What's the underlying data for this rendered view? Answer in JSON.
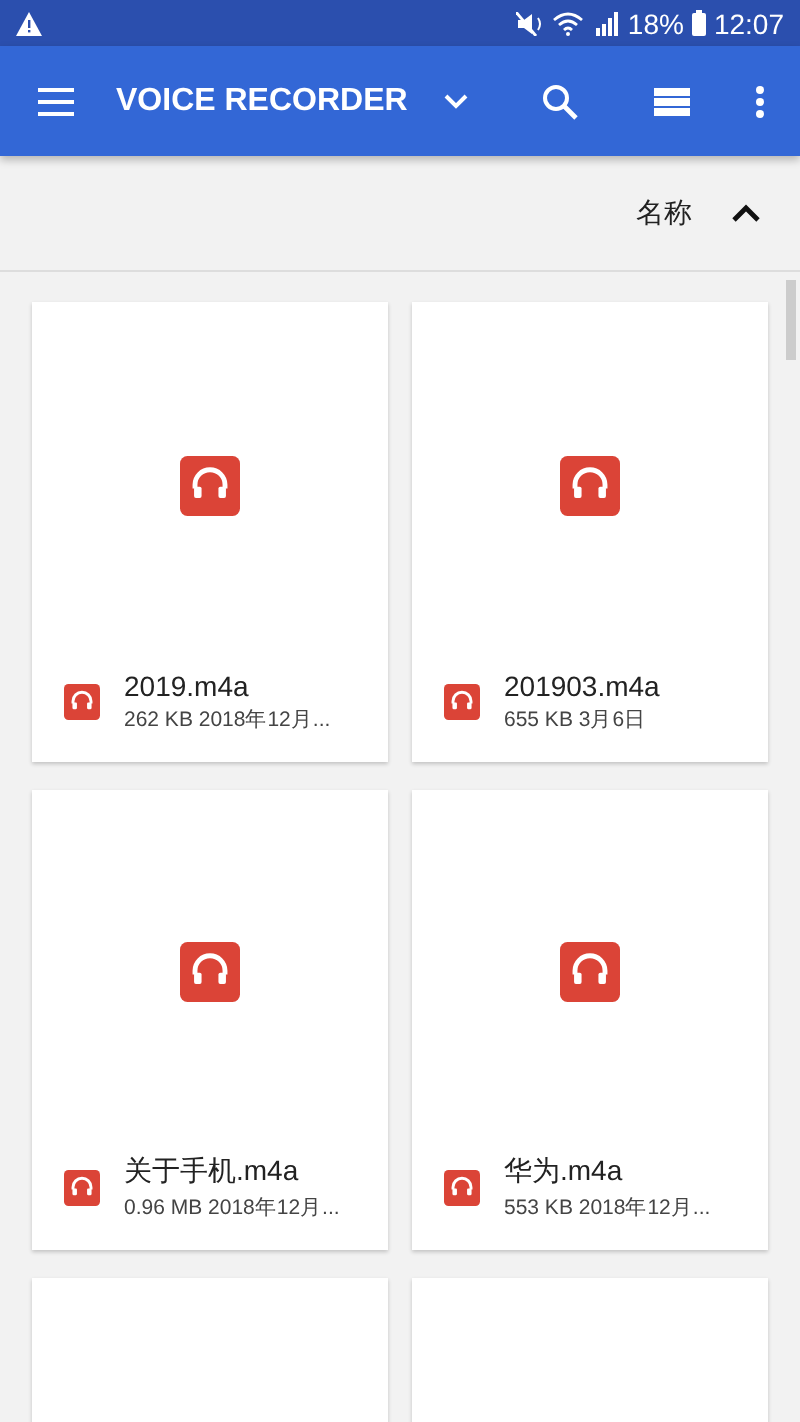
{
  "status_bar": {
    "battery": "18%",
    "time": "12:07"
  },
  "app_bar": {
    "title": "VOICE RECORDER"
  },
  "sort_bar": {
    "label": "名称"
  },
  "files": [
    {
      "kind": "file",
      "name": "2019.m4a",
      "details": "262 KB 2018年12月..."
    },
    {
      "kind": "file",
      "name": "201903.m4a",
      "details": "655 KB 3月6日"
    },
    {
      "kind": "file",
      "name": "关于手机.m4a",
      "details": "0.96 MB 2018年12月..."
    },
    {
      "kind": "file",
      "name": "华为.m4a",
      "details": "553 KB 2018年12月..."
    },
    {
      "kind": "cut"
    },
    {
      "kind": "cut"
    }
  ]
}
